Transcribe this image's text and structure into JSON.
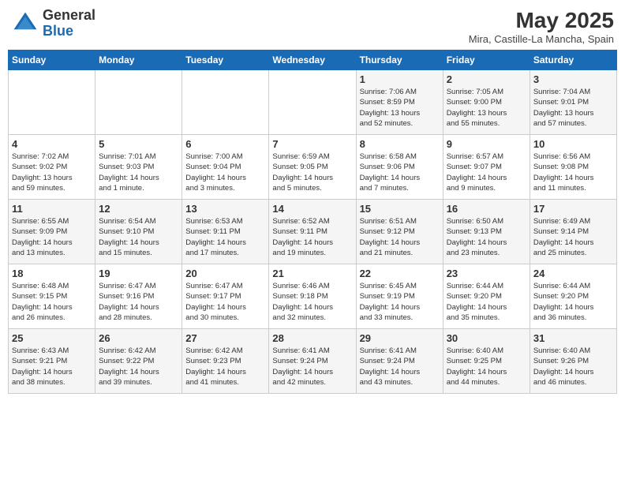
{
  "header": {
    "logo_general": "General",
    "logo_blue": "Blue",
    "month_title": "May 2025",
    "subtitle": "Mira, Castille-La Mancha, Spain"
  },
  "days_of_week": [
    "Sunday",
    "Monday",
    "Tuesday",
    "Wednesday",
    "Thursday",
    "Friday",
    "Saturday"
  ],
  "weeks": [
    [
      {
        "day": "",
        "info": ""
      },
      {
        "day": "",
        "info": ""
      },
      {
        "day": "",
        "info": ""
      },
      {
        "day": "",
        "info": ""
      },
      {
        "day": "1",
        "info": "Sunrise: 7:06 AM\nSunset: 8:59 PM\nDaylight: 13 hours\nand 52 minutes."
      },
      {
        "day": "2",
        "info": "Sunrise: 7:05 AM\nSunset: 9:00 PM\nDaylight: 13 hours\nand 55 minutes."
      },
      {
        "day": "3",
        "info": "Sunrise: 7:04 AM\nSunset: 9:01 PM\nDaylight: 13 hours\nand 57 minutes."
      }
    ],
    [
      {
        "day": "4",
        "info": "Sunrise: 7:02 AM\nSunset: 9:02 PM\nDaylight: 13 hours\nand 59 minutes."
      },
      {
        "day": "5",
        "info": "Sunrise: 7:01 AM\nSunset: 9:03 PM\nDaylight: 14 hours\nand 1 minute."
      },
      {
        "day": "6",
        "info": "Sunrise: 7:00 AM\nSunset: 9:04 PM\nDaylight: 14 hours\nand 3 minutes."
      },
      {
        "day": "7",
        "info": "Sunrise: 6:59 AM\nSunset: 9:05 PM\nDaylight: 14 hours\nand 5 minutes."
      },
      {
        "day": "8",
        "info": "Sunrise: 6:58 AM\nSunset: 9:06 PM\nDaylight: 14 hours\nand 7 minutes."
      },
      {
        "day": "9",
        "info": "Sunrise: 6:57 AM\nSunset: 9:07 PM\nDaylight: 14 hours\nand 9 minutes."
      },
      {
        "day": "10",
        "info": "Sunrise: 6:56 AM\nSunset: 9:08 PM\nDaylight: 14 hours\nand 11 minutes."
      }
    ],
    [
      {
        "day": "11",
        "info": "Sunrise: 6:55 AM\nSunset: 9:09 PM\nDaylight: 14 hours\nand 13 minutes."
      },
      {
        "day": "12",
        "info": "Sunrise: 6:54 AM\nSunset: 9:10 PM\nDaylight: 14 hours\nand 15 minutes."
      },
      {
        "day": "13",
        "info": "Sunrise: 6:53 AM\nSunset: 9:11 PM\nDaylight: 14 hours\nand 17 minutes."
      },
      {
        "day": "14",
        "info": "Sunrise: 6:52 AM\nSunset: 9:11 PM\nDaylight: 14 hours\nand 19 minutes."
      },
      {
        "day": "15",
        "info": "Sunrise: 6:51 AM\nSunset: 9:12 PM\nDaylight: 14 hours\nand 21 minutes."
      },
      {
        "day": "16",
        "info": "Sunrise: 6:50 AM\nSunset: 9:13 PM\nDaylight: 14 hours\nand 23 minutes."
      },
      {
        "day": "17",
        "info": "Sunrise: 6:49 AM\nSunset: 9:14 PM\nDaylight: 14 hours\nand 25 minutes."
      }
    ],
    [
      {
        "day": "18",
        "info": "Sunrise: 6:48 AM\nSunset: 9:15 PM\nDaylight: 14 hours\nand 26 minutes."
      },
      {
        "day": "19",
        "info": "Sunrise: 6:47 AM\nSunset: 9:16 PM\nDaylight: 14 hours\nand 28 minutes."
      },
      {
        "day": "20",
        "info": "Sunrise: 6:47 AM\nSunset: 9:17 PM\nDaylight: 14 hours\nand 30 minutes."
      },
      {
        "day": "21",
        "info": "Sunrise: 6:46 AM\nSunset: 9:18 PM\nDaylight: 14 hours\nand 32 minutes."
      },
      {
        "day": "22",
        "info": "Sunrise: 6:45 AM\nSunset: 9:19 PM\nDaylight: 14 hours\nand 33 minutes."
      },
      {
        "day": "23",
        "info": "Sunrise: 6:44 AM\nSunset: 9:20 PM\nDaylight: 14 hours\nand 35 minutes."
      },
      {
        "day": "24",
        "info": "Sunrise: 6:44 AM\nSunset: 9:20 PM\nDaylight: 14 hours\nand 36 minutes."
      }
    ],
    [
      {
        "day": "25",
        "info": "Sunrise: 6:43 AM\nSunset: 9:21 PM\nDaylight: 14 hours\nand 38 minutes."
      },
      {
        "day": "26",
        "info": "Sunrise: 6:42 AM\nSunset: 9:22 PM\nDaylight: 14 hours\nand 39 minutes."
      },
      {
        "day": "27",
        "info": "Sunrise: 6:42 AM\nSunset: 9:23 PM\nDaylight: 14 hours\nand 41 minutes."
      },
      {
        "day": "28",
        "info": "Sunrise: 6:41 AM\nSunset: 9:24 PM\nDaylight: 14 hours\nand 42 minutes."
      },
      {
        "day": "29",
        "info": "Sunrise: 6:41 AM\nSunset: 9:24 PM\nDaylight: 14 hours\nand 43 minutes."
      },
      {
        "day": "30",
        "info": "Sunrise: 6:40 AM\nSunset: 9:25 PM\nDaylight: 14 hours\nand 44 minutes."
      },
      {
        "day": "31",
        "info": "Sunrise: 6:40 AM\nSunset: 9:26 PM\nDaylight: 14 hours\nand 46 minutes."
      }
    ]
  ]
}
